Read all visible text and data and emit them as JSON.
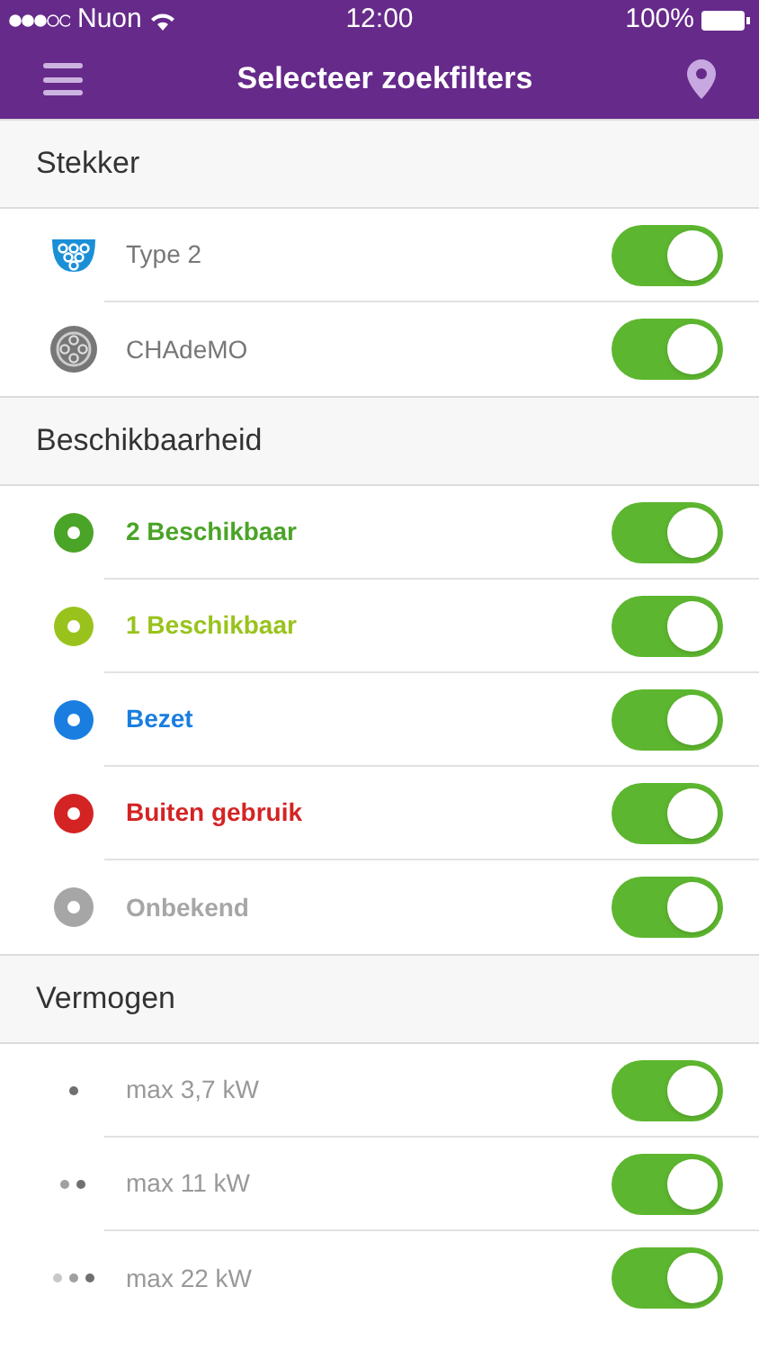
{
  "status_bar": {
    "carrier": "Nuon",
    "time": "12:00",
    "battery": "100%"
  },
  "nav": {
    "title": "Selecteer zoekfilters"
  },
  "sections": [
    {
      "title": "Stekker",
      "items": [
        {
          "kind": "type2",
          "label": "Type 2",
          "on": true
        },
        {
          "kind": "chademo",
          "label": "CHAdeMO",
          "on": true
        }
      ]
    },
    {
      "title": "Beschikbaarheid",
      "items": [
        {
          "kind": "status",
          "label": "2 Beschikbaar",
          "color": "#4aa427",
          "on": true
        },
        {
          "kind": "status",
          "label": "1 Beschikbaar",
          "color": "#99c31c",
          "on": true
        },
        {
          "kind": "status",
          "label": "Bezet",
          "color": "#1a7ee0",
          "on": true
        },
        {
          "kind": "status",
          "label": "Buiten gebruik",
          "color": "#d42323",
          "on": true
        },
        {
          "kind": "status",
          "label": "Onbekend",
          "color": "#a6a6a6",
          "on": true
        }
      ]
    },
    {
      "title": "Vermogen",
      "items": [
        {
          "kind": "power1",
          "label": "max 3,7 kW",
          "on": true
        },
        {
          "kind": "power2",
          "label": "max 11 kW",
          "on": true
        },
        {
          "kind": "power3",
          "label": "max 22 kW",
          "on": true
        }
      ]
    }
  ]
}
